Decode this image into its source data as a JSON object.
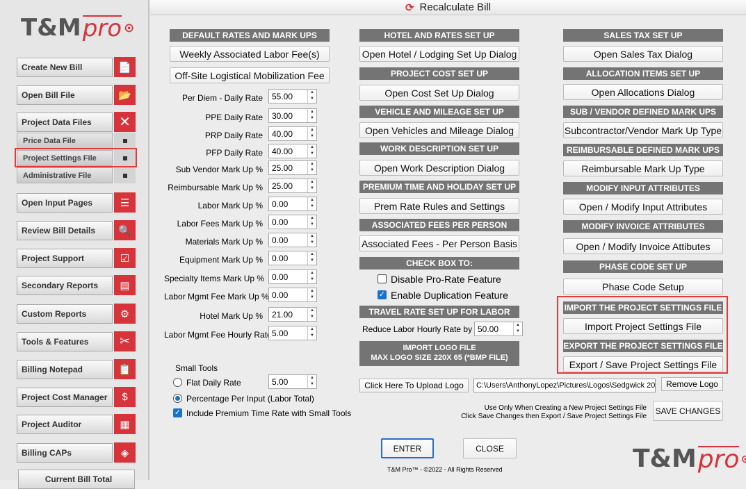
{
  "app": {
    "title": "Recalculate Bill",
    "logo_main": "T&M",
    "logo_pro": "pro"
  },
  "sidebar": {
    "items": [
      {
        "label": "Create New Bill",
        "icon": "new-document-icon"
      },
      {
        "label": "Open Bill File",
        "icon": "folder-open-icon"
      },
      {
        "label": "Project Data Files",
        "icon": "close-icon"
      },
      {
        "label": "Open Input Pages",
        "icon": "form-icon"
      },
      {
        "label": "Review Bill Details",
        "icon": "search-document-icon"
      },
      {
        "label": "Project Support",
        "icon": "checklist-icon"
      },
      {
        "label": "Secondary Reports",
        "icon": "report-icon"
      },
      {
        "label": "Custom Reports",
        "icon": "gear-document-icon"
      },
      {
        "label": "Tools & Features",
        "icon": "tools-icon"
      },
      {
        "label": "Billing Notepad",
        "icon": "notepad-icon"
      },
      {
        "label": "Project Cost Manager",
        "icon": "dollar-document-icon"
      },
      {
        "label": "Project Auditor",
        "icon": "calculator-icon"
      },
      {
        "label": "Billing CAPs",
        "icon": "layers-icon"
      },
      {
        "label": "Current Bill Total"
      }
    ],
    "subitems": [
      {
        "label": "Price Data File"
      },
      {
        "label": "Project Settings File"
      },
      {
        "label": "Administrative File"
      }
    ]
  },
  "rates": {
    "header": "DEFAULT RATES AND MARK UPS",
    "weekly_btn": "Weekly Associated  Labor Fee(s)",
    "offsite_btn": "Off-Site Logistical Mobilization Fee",
    "fields": [
      {
        "label": "Per Diem - Daily Rate",
        "value": "55.00"
      },
      {
        "label": "PPE Daily Rate",
        "value": "30.00"
      },
      {
        "label": "PRP Daily Rate",
        "value": "40.00"
      },
      {
        "label": "PFP Daily Rate",
        "value": "40.00"
      },
      {
        "label": "Sub Vendor Mark Up %",
        "value": "25.00"
      },
      {
        "label": "Reimbursable Mark Up %",
        "value": "25.00"
      },
      {
        "label": "Labor Mark Up  %",
        "value": "0.00"
      },
      {
        "label": "Labor Fees Mark Up  %",
        "value": "0.00"
      },
      {
        "label": "Materials Mark Up  %",
        "value": "0.00"
      },
      {
        "label": "Equipment Mark Up  %",
        "value": "0.00"
      },
      {
        "label": "Specialty Items Mark Up  %",
        "value": "0.00"
      },
      {
        "label": "Labor Mgmt Fee Mark Up  %",
        "value": "0.00"
      },
      {
        "label": "Hotel Mark Up  %",
        "value": "21.00"
      },
      {
        "label": "Labor Mgmt Fee Hourly Rate",
        "value": "5.00"
      }
    ],
    "small_tools": {
      "label": "Small Tools",
      "flat_label": "Flat Daily Rate",
      "flat_value": "5.00",
      "pct_label": "Percentage Per Input (Labor Total)",
      "premium_label": "Include Premium Time Rate with Small Tools"
    }
  },
  "middle": {
    "sections": [
      {
        "header": "HOTEL AND RATES SET UP",
        "button": "Open Hotel / Lodging Set Up Dialog"
      },
      {
        "header": "PROJECT COST SET UP",
        "button": "Open Cost Set Up Dialog"
      },
      {
        "header": "VEHICLE AND MILEAGE SET UP",
        "button": "Open Vehicles and Mileage Dialog"
      },
      {
        "header": "WORK DESCRIPTION SET UP",
        "button": "Open Work Description Dialog"
      },
      {
        "header": "PREMIUM TIME AND HOLIDAY SET UP",
        "button": "Prem Rate Rules and Settings"
      },
      {
        "header": "ASSOCIATED FEES PER PERSON",
        "button": "Associated Fees  - Per Person Basis"
      }
    ],
    "checkbox_header": "CHECK BOX TO:",
    "disable_prorate": "Disable Pro-Rate Feature",
    "enable_dup": "Enable Duplication Feature",
    "travel_header": "TRAVEL RATE SET UP FOR LABOR",
    "travel_label": "Reduce Labor Hourly Rate by %",
    "travel_value": "50.00",
    "logo_header_1": "IMPORT LOGO FILE",
    "logo_header_2": "MAX LOGO SIZE 220X 65 (*BMP FILE)",
    "upload_btn": "Click Here To Upload Logo",
    "logo_path": "C:\\Users\\AnthonyLopez\\Pictures\\Logos\\Sedgwick 20",
    "remove_btn": "Remove Logo"
  },
  "right": {
    "sections": [
      {
        "header": "SALES TAX SET UP",
        "button": "Open Sales Tax Dialog"
      },
      {
        "header": "ALLOCATION ITEMS SET UP",
        "button": "Open Allocations Dialog"
      },
      {
        "header": "SUB / VENDOR DEFINED MARK UPS",
        "button": "Subcontractor/Vendor Mark Up Type"
      },
      {
        "header": "REIMBURSABLE DEFINED MARK UPS",
        "button": "Reimbursable Mark Up Type"
      },
      {
        "header": "MODIFY INPUT ATTRIBUTES",
        "button": "Open / Modify Input Attributes"
      },
      {
        "header": "MODIFY INVOICE ATTRIBUTES",
        "button": "Open / Modify  Invoice Attibutes"
      },
      {
        "header": "PHASE CODE SET UP",
        "button": "Phase Code Setup"
      },
      {
        "header": "IMPORT THE PROJECT SETTINGS FILE",
        "button": "Import Project Settings File"
      },
      {
        "header": "EXPORT THE PROJECT SETTINGS FILE",
        "button": "Export / Save Project  Settings File"
      }
    ],
    "note_1": "Use Only When Creating a New Project Settings File",
    "note_2": "Click Save Changes then Export / Save Project Settings File",
    "save_btn": "SAVE CHANGES"
  },
  "footer": {
    "enter": "ENTER",
    "close": "CLOSE",
    "copyright": "T&M Pro™ - ©2022 - All Rights Reserved"
  },
  "colors": {
    "accent": "#d6333a",
    "header_bg": "#747474",
    "highlight": "#e53935"
  }
}
